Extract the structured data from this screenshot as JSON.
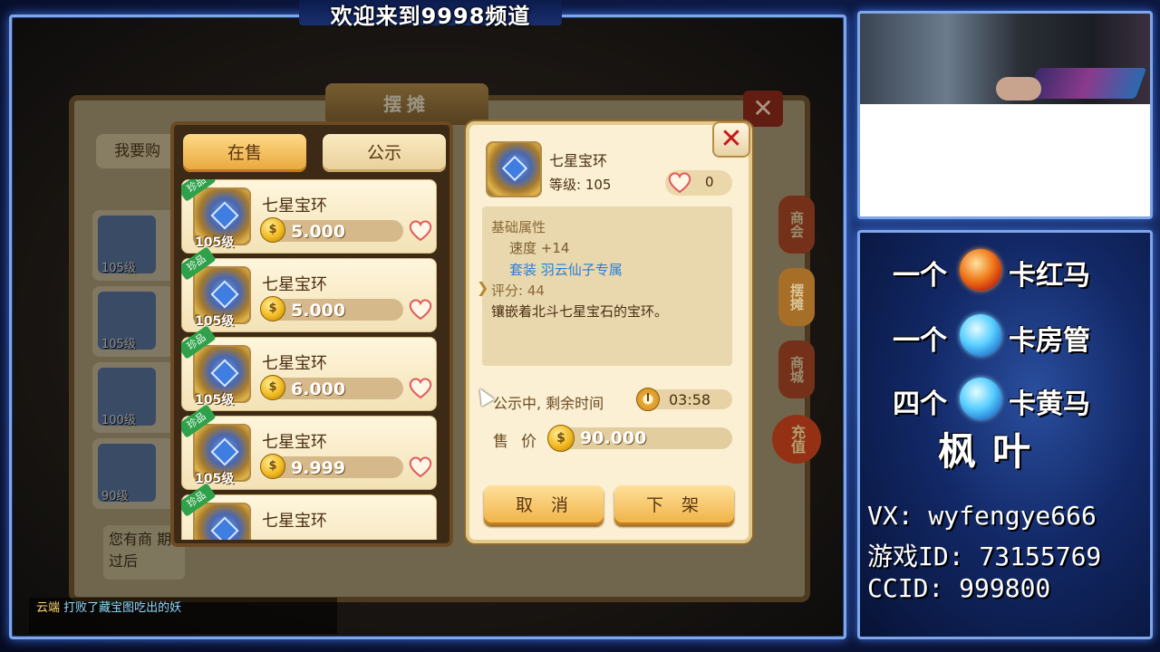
{
  "overlay": {
    "channel_title": "欢迎来到9998频道"
  },
  "game": {
    "stall_title": "摆摊",
    "back_tab": "我要购",
    "side_buttons": [
      "商会",
      "摆摊",
      "商城"
    ],
    "recharge": "充值",
    "back_rows": [
      {
        "level": "105级"
      },
      {
        "level": "105级"
      },
      {
        "level": "100级"
      },
      {
        "level": "90级"
      }
    ],
    "back_note": "您有商 期过后",
    "chat": {
      "line1_name": "云端",
      "line1": "打败了藏宝图吃出的妖"
    },
    "tabs": {
      "on_sale": "在售",
      "public": "公示"
    },
    "items": [
      {
        "name": "七星宝环",
        "rarity": "珍品",
        "level": "105级",
        "price": "5.000"
      },
      {
        "name": "七星宝环",
        "rarity": "珍品",
        "level": "105级",
        "price": "5.000"
      },
      {
        "name": "七星宝环",
        "rarity": "珍品",
        "level": "105级",
        "price": "6.000"
      },
      {
        "name": "七星宝环",
        "rarity": "珍品",
        "level": "105级",
        "price": "9.999"
      },
      {
        "name": "七星宝环",
        "rarity": "珍品",
        "level": "",
        "price": ""
      }
    ],
    "detail": {
      "name": "七星宝环",
      "level": "等级: 105",
      "favorites": "0",
      "attr_header": "基础属性",
      "speed": "速度 +14",
      "suit": "套装  羽云仙子专属",
      "score": "评分: 44",
      "desc": "镶嵌着北斗七星宝石的宝环。",
      "public_label": "公示中, 剩余时间",
      "timer": "03:58",
      "price_label": "售价",
      "price": "90.000",
      "cancel": "取消",
      "delist": "下架"
    }
  },
  "sidebar": {
    "tickets": [
      {
        "prefix": "一个",
        "label": "卡红马",
        "ball": "red"
      },
      {
        "prefix": "一个",
        "label": "卡房管",
        "ball": "blue"
      },
      {
        "prefix": "四个",
        "label": "卡黄马",
        "ball": "blue"
      }
    ],
    "streamer": "枫叶",
    "vx": "VX: wyfengye666",
    "game_id": "游戏ID: 73155769",
    "ccid": "CCID:   999800"
  },
  "colors": {
    "frame": "#7fa6e6",
    "accent_gold": "#f0b143",
    "heart": "#e05a5a"
  }
}
